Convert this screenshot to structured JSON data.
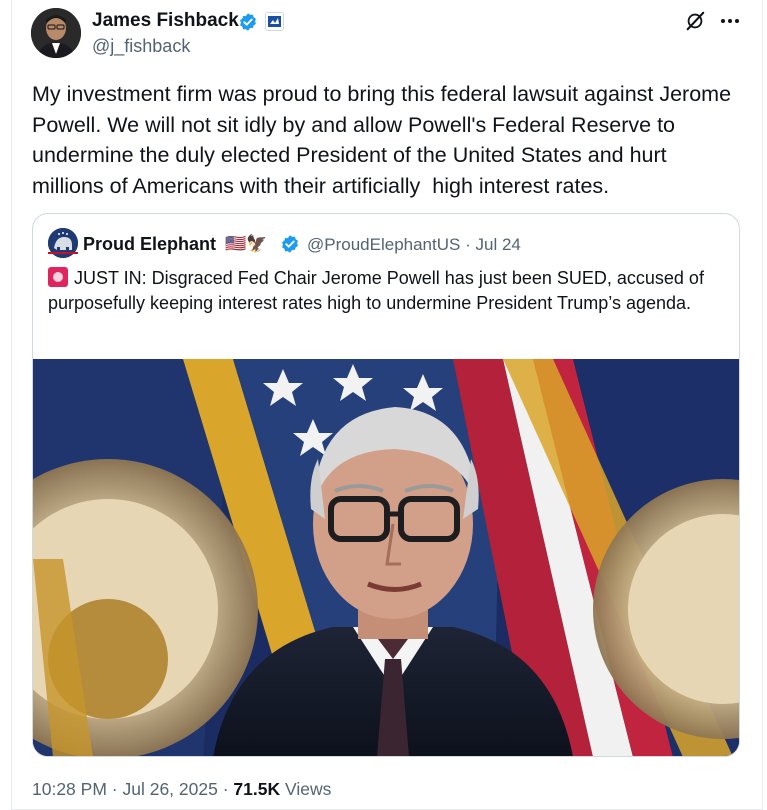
{
  "author": {
    "name": "James Fishback",
    "handle": "@j_fishback"
  },
  "tweet": {
    "text": "My investment firm was proud to bring this federal lawsuit against Jerome Powell. We will not sit idly by and allow Powell's Federal Reserve to undermine the duly elected President of the United States and hurt millions of Americans with their artificially  high interest rates."
  },
  "quoted": {
    "name": "Proud Elephant",
    "flags": "🇺🇸🦅",
    "handle": "@ProudElephantUS",
    "separator": "·",
    "date": "Jul 24",
    "text": "JUST IN: Disgraced Fed Chair Jerome Powell has just been SUED, accused of purposefully keeping interest rates high to undermine President Trump’s agenda.",
    "image_alt": "Federal Reserve Chair at a press conference in front of flags"
  },
  "footer": {
    "time": "10:28 PM",
    "date": "Jul 26, 2025",
    "views_count": "71.5K",
    "views_label": "Views"
  },
  "colors": {
    "accent": "#1d9bf0",
    "text": "#0f1419",
    "secondary": "#536471"
  },
  "icons": {
    "verified": "verified-badge-icon",
    "affiliate": "affiliate-badge-icon",
    "grok": "grok-icon",
    "more": "more-icon",
    "siren": "siren-icon"
  }
}
